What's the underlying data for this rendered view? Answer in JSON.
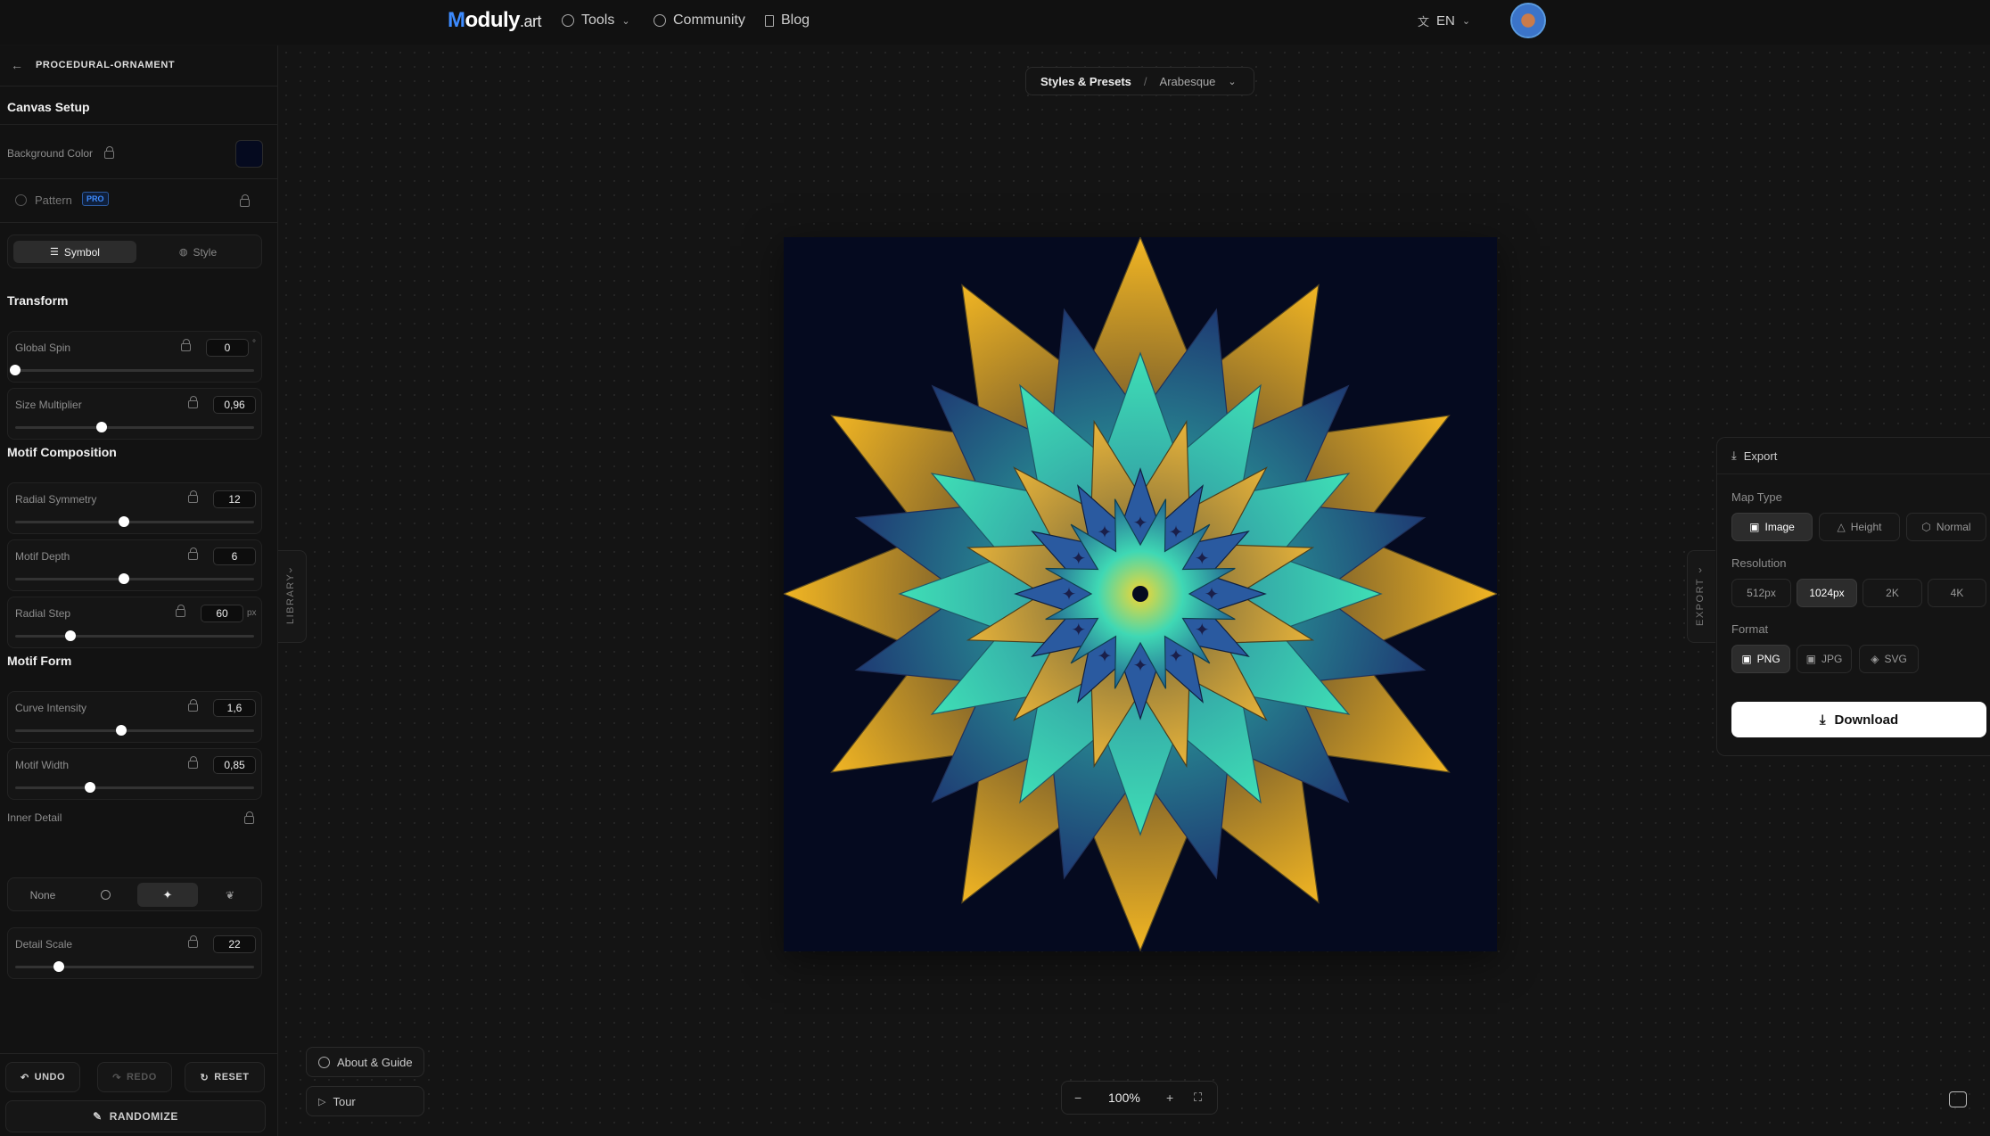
{
  "nav": {
    "logo_m": "M",
    "logo_rest": "oduly",
    "logo_suffix": ".art",
    "tools": "Tools",
    "community": "Community",
    "blog": "Blog",
    "language": "EN"
  },
  "sidebar": {
    "project": "PROCEDURAL-ORNAMENT",
    "canvas_setup": "Canvas Setup",
    "background_color_label": "Background Color",
    "background_color": "#050a1f",
    "pattern_label": "Pattern",
    "pro_badge": "PRO",
    "tabs": [
      {
        "label": "Symbol",
        "active": true
      },
      {
        "label": "Style",
        "active": false
      }
    ],
    "transform": "Transform",
    "global_spin": {
      "label": "Global Spin",
      "value": "0",
      "unit": "°",
      "fraction": 0.0
    },
    "size_multiplier": {
      "label": "Size Multiplier",
      "value": "0,96",
      "fraction": 0.36
    },
    "motif_composition": "Motif Composition",
    "radial_symmetry": {
      "label": "Radial Symmetry",
      "value": "12",
      "fraction": 0.45
    },
    "motif_depth": {
      "label": "Motif Depth",
      "value": "6",
      "fraction": 0.45
    },
    "radial_step": {
      "label": "Radial Step",
      "value": "60",
      "unit": "px",
      "fraction": 0.23
    },
    "motif_form": "Motif Form",
    "curve_intensity": {
      "label": "Curve Intensity",
      "value": "1,6",
      "fraction": 0.44
    },
    "motif_width": {
      "label": "Motif Width",
      "value": "0,85",
      "fraction": 0.31
    },
    "inner_detail_label": "Inner Detail",
    "inner_detail_options": [
      "None",
      "circle-icon",
      "sparkle-icon",
      "leaf-icon"
    ],
    "inner_detail_selected": "sparkle-icon",
    "detail_scale": {
      "label": "Detail Scale",
      "value": "22",
      "fraction": 0.18
    },
    "undo": "UNDO",
    "redo": "REDO",
    "reset": "RESET",
    "randomize": "RANDOMIZE"
  },
  "library_tab": "LIBRARY",
  "export_tab": "EXPORT",
  "breadcrumb": {
    "root": "Styles & Presets",
    "separator": "/",
    "current": "Arabesque"
  },
  "export": {
    "title": "Export",
    "map_type_label": "Map Type",
    "map_types": [
      {
        "label": "Image",
        "active": true
      },
      {
        "label": "Height",
        "active": false
      },
      {
        "label": "Normal",
        "active": false
      }
    ],
    "resolution_label": "Resolution",
    "resolutions": [
      {
        "label": "512px",
        "active": false
      },
      {
        "label": "1024px",
        "active": true
      },
      {
        "label": "2K",
        "active": false
      },
      {
        "label": "4K",
        "active": false
      }
    ],
    "format_label": "Format",
    "formats": [
      {
        "label": "PNG",
        "active": true
      },
      {
        "label": "JPG",
        "active": false
      },
      {
        "label": "SVG",
        "active": false
      }
    ],
    "download": "Download"
  },
  "bottom": {
    "about": "About & Guide",
    "tour": "Tour",
    "zoom": "100%"
  },
  "colors": {
    "accent": "#3d8bff",
    "art_bg": "#050a1f",
    "gold": "#f2b623",
    "teal": "#3fe0b6",
    "navy": "#1e3a73"
  }
}
